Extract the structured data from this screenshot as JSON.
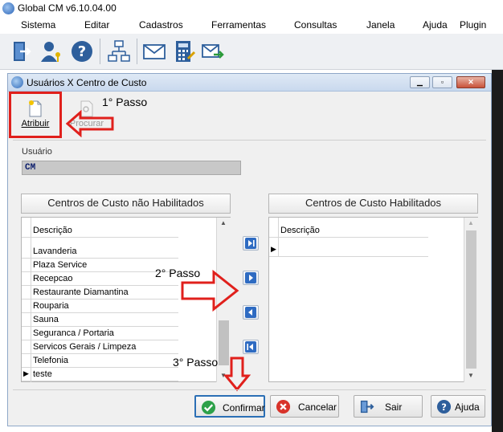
{
  "app": {
    "title": "Global CM v6.10.04.00"
  },
  "menu": [
    "Sistema",
    "Editar",
    "Cadastros",
    "Ferramentas",
    "Consultas",
    "Janela",
    "Ajuda",
    "Plugin"
  ],
  "toolbar": {
    "icons": [
      "exit-icon",
      "user-key-icon",
      "help-icon",
      "org-chart-icon",
      "mail-icon",
      "calculator-icon",
      "mail-send-icon"
    ]
  },
  "dialog": {
    "title": "Usuários X Centro de Custo",
    "actions": {
      "atribuir": "Atribuir",
      "procurar": "Procurar"
    },
    "usuario_label": "Usuário",
    "usuario_value": "CM",
    "left_header": "Centros de Custo não Habilitados",
    "right_header": "Centros de Custo Habilitados",
    "column_descricao": "Descrição",
    "left_items": [
      "Lavanderia",
      "Plaza Service",
      "Recepcao",
      "Restaurante Diamantina",
      "Rouparia",
      "Sauna",
      "Seguranca / Portaria",
      "Servicos Gerais / Limpeza",
      "Telefonia",
      "teste"
    ],
    "left_selected_index": 9,
    "buttons": {
      "confirmar": "Confirmar",
      "cancelar": "Cancelar",
      "sair": "Sair",
      "ajuda": "Ajuda"
    }
  },
  "annotations": {
    "step1": "1° Passo",
    "step2": "2° Passo",
    "step3": "3° Passo"
  },
  "colors": {
    "highlight": "#e0201c",
    "accent": "#2b6fb5"
  }
}
